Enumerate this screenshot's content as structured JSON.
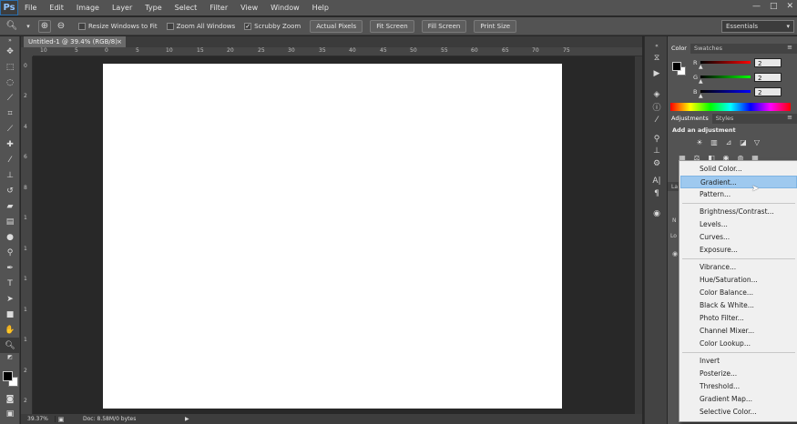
{
  "app": {
    "logo": "Ps"
  },
  "menubar": {
    "items": [
      "File",
      "Edit",
      "Image",
      "Layer",
      "Type",
      "Select",
      "Filter",
      "View",
      "Window",
      "Help"
    ]
  },
  "window_controls": {
    "minimize": "—",
    "maximize": "□",
    "close": "✕"
  },
  "options_bar": {
    "checkboxes": [
      {
        "label": "Resize Windows to Fit",
        "checked": false
      },
      {
        "label": "Zoom All Windows",
        "checked": false
      },
      {
        "label": "Scrubby Zoom",
        "checked": true
      }
    ],
    "buttons": [
      "Actual Pixels",
      "Fit Screen",
      "Fill Screen",
      "Print Size"
    ],
    "workspace": "Essentials"
  },
  "document": {
    "tab_title": "Untitled-1 @ 39.4% (RGB/8)",
    "tab_close": "×",
    "ruler_h_labels": [
      "10",
      "5",
      "0",
      "5",
      "10",
      "15",
      "20",
      "25",
      "30",
      "35",
      "40",
      "45",
      "50",
      "55",
      "60",
      "65",
      "70",
      "75"
    ],
    "ruler_v_labels": [
      "0",
      "2",
      "4",
      "6",
      "8",
      "1",
      "1",
      "1",
      "1",
      "1",
      "2",
      "2"
    ]
  },
  "status": {
    "zoom": "39.37%",
    "doc_info": "Doc: 8.58M/0 bytes"
  },
  "color_panel": {
    "tabs": [
      "Color",
      "Swatches"
    ],
    "channels": [
      {
        "label": "R",
        "value": "2"
      },
      {
        "label": "G",
        "value": "2"
      },
      {
        "label": "B",
        "value": "2"
      }
    ]
  },
  "adjustments_panel": {
    "tabs": [
      "Adjustments",
      "Styles"
    ],
    "title": "Add an adjustment",
    "partial_labels": [
      "La",
      "N",
      "Lo"
    ]
  },
  "adjustment_menu": {
    "groups": [
      [
        "Solid Color...",
        "Gradient...",
        "Pattern..."
      ],
      [
        "Brightness/Contrast...",
        "Levels...",
        "Curves...",
        "Exposure..."
      ],
      [
        "Vibrance...",
        "Hue/Saturation...",
        "Color Balance...",
        "Black & White...",
        "Photo Filter...",
        "Channel Mixer...",
        "Color Lookup..."
      ],
      [
        "Invert",
        "Posterize...",
        "Threshold...",
        "Gradient Map...",
        "Selective Color..."
      ]
    ],
    "highlighted": "Gradient..."
  },
  "colors": {
    "ui_dark": "#282828",
    "ui_panel": "#535353",
    "highlight": "#9ec9ef"
  }
}
